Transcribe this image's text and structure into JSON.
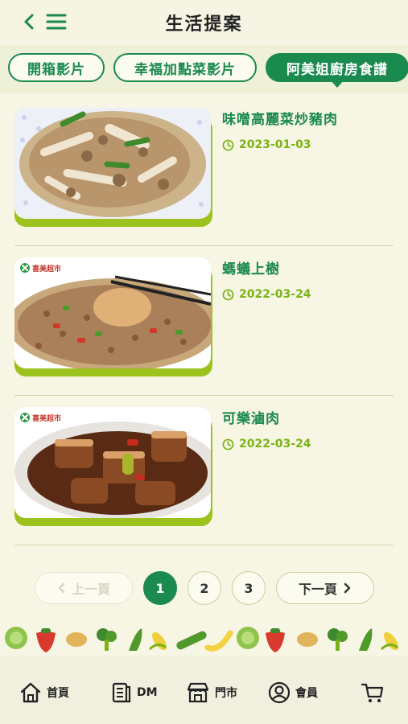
{
  "header": {
    "title": "生活提案"
  },
  "tabs": [
    {
      "label": "開箱影片"
    },
    {
      "label": "幸福加點菜影片"
    },
    {
      "label": "阿美姐廚房食譜"
    }
  ],
  "items": [
    {
      "title": "味噌高麗菜炒豬肉",
      "date": "2023-01-03",
      "brand": ""
    },
    {
      "title": "螞蟻上樹",
      "date": "2022-03-24",
      "brand": "喜美超市"
    },
    {
      "title": "可樂滷肉",
      "date": "2022-03-24",
      "brand": "喜美超市"
    }
  ],
  "pagination": {
    "prev": "上一頁",
    "pages": [
      "1",
      "2",
      "3"
    ],
    "current": "1",
    "next": "下一頁"
  },
  "bottom_nav": [
    {
      "label": "首頁",
      "icon": "home-icon"
    },
    {
      "label": "DM",
      "icon": "flyer-icon"
    },
    {
      "label": "門市",
      "icon": "store-icon"
    },
    {
      "label": "會員",
      "icon": "member-icon"
    },
    {
      "label": "",
      "icon": "cart-icon"
    }
  ],
  "colors": {
    "primary": "#1a8a4f",
    "accent": "#9cc21d",
    "date": "#7ab316",
    "background": "#f7f5e4"
  }
}
